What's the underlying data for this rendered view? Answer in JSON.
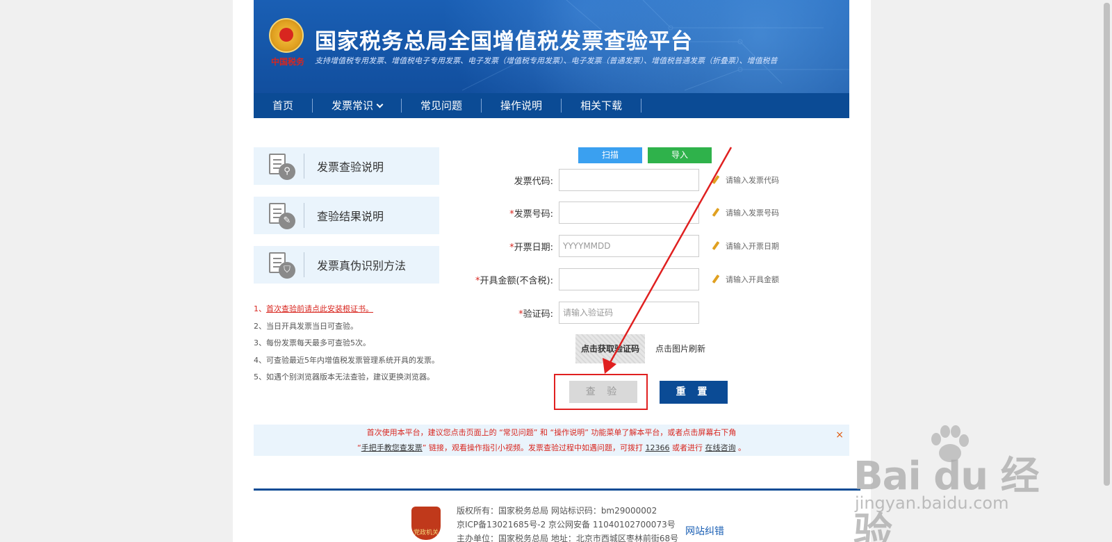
{
  "header": {
    "title": "国家税务总局全国增值税发票查验平台",
    "subtitle": "支持增值税专用发票、增值税电子专用发票、电子发票（增值税专用发票）、电子发票（普通发票）、增值税普通发票（折叠票）、增值税普",
    "emblem_text": "中国税务"
  },
  "nav": {
    "items": [
      "首页",
      "发票常识",
      "常见问题",
      "操作说明",
      "相关下载"
    ]
  },
  "sidebar": {
    "cards": [
      {
        "label": "发票查验说明",
        "icon": "search-icon"
      },
      {
        "label": "查验结果说明",
        "icon": "pen-icon"
      },
      {
        "label": "发票真伪识别方法",
        "icon": "shield-icon"
      }
    ],
    "notes": [
      "1、首次查验前请点此安装根证书。",
      "2、当日开具发票当日可查验。",
      "3、每份发票每天最多可查验5次。",
      "4、可查验最近5年内增值税发票管理系统开具的发票。",
      "5、如遇个别浏览器版本无法查验，建议更换浏览器。"
    ],
    "note1_prefix": "1、",
    "note1_link": "首次查验前请点此安装根证书。"
  },
  "actions": {
    "scan_label": "扫描",
    "import_label": "导入",
    "scan_color": "#3aa0f0",
    "import_color": "#2fb24b"
  },
  "form": {
    "fields": [
      {
        "label": "发票代码:",
        "required": false,
        "value": "",
        "placeholder": "",
        "hint": "请输入发票代码"
      },
      {
        "label": "发票号码:",
        "required": true,
        "value": "",
        "placeholder": "",
        "hint": "请输入发票号码"
      },
      {
        "label": "开票日期:",
        "required": true,
        "value": "",
        "placeholder": "YYYYMMDD",
        "hint": "请输入开票日期"
      },
      {
        "label": "开具金额(不含税):",
        "required": true,
        "value": "",
        "placeholder": "",
        "hint": "请输入开具金额"
      },
      {
        "label": "验证码:",
        "required": true,
        "value": "",
        "placeholder": "请输入验证码",
        "hint": ""
      }
    ],
    "captcha_image_text": "点击获取验证码",
    "captcha_tip": "点击图片刷新",
    "check_label": "查 验",
    "reset_label": "重 置"
  },
  "notice": {
    "line1": "首次使用本平台，建议您点击页面上的 “常见问题” 和 “操作说明” 功能菜单了解本平台，或者点击屏幕右下角",
    "line2_a": "“",
    "line2_link1": "手把手教您查发票",
    "line2_b": "” 链接，观看操作指引小视频。发票查验过程中如遇问题，可拨打 ",
    "line2_phone": "12366",
    "line2_c": " 或者进行 ",
    "line2_link2": "在线咨询",
    "line2_d": " 。",
    "close": "×"
  },
  "footer": {
    "line1": "版权所有：国家税务总局 网站标识码：bm29000002",
    "line2": "京ICP备13021685号-2 京公网安备 11040102700073号",
    "line3": "主办单位：国家税务总局 地址：北京市西城区枣林前街68号",
    "link": "网站纠错",
    "logo_text": "党政机关"
  },
  "watermark": {
    "brand": "Bai du 经验",
    "url": "jingyan.baidu.com"
  }
}
